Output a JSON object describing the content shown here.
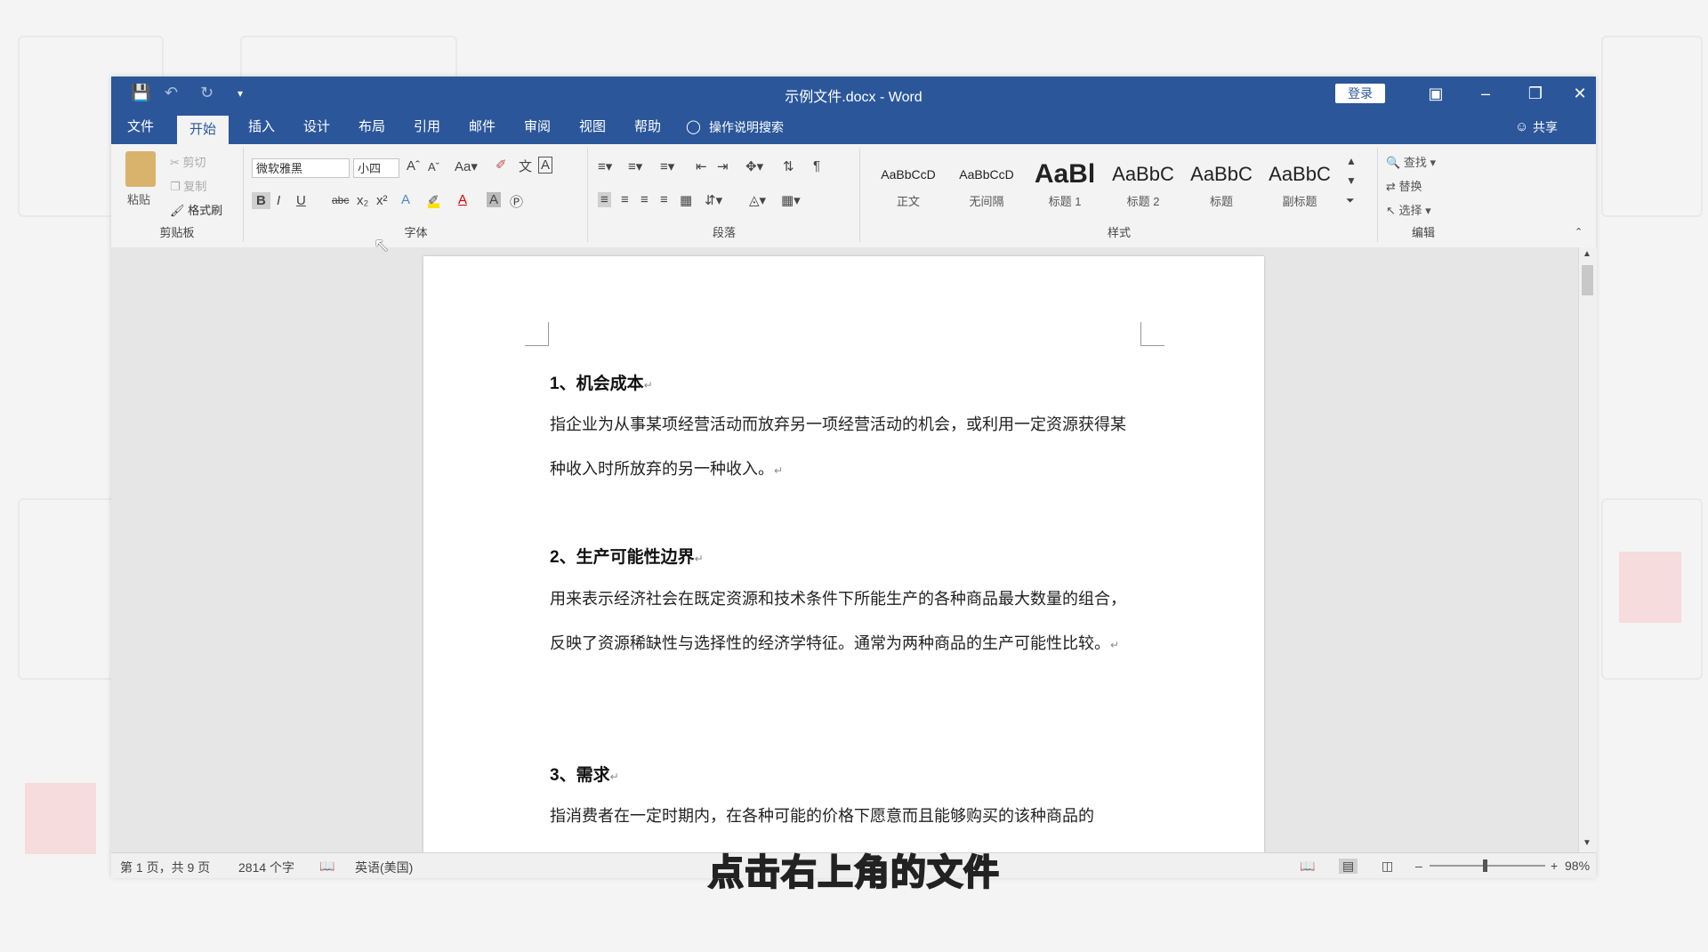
{
  "window": {
    "title": "示例文件.docx  -  Word",
    "login_label": "登录",
    "share_label": "共享"
  },
  "tabs": [
    "文件",
    "开始",
    "插入",
    "设计",
    "布局",
    "引用",
    "邮件",
    "审阅",
    "视图",
    "帮助"
  ],
  "active_tab": "开始",
  "tell_me": "操作说明搜索",
  "ribbon": {
    "clipboard": {
      "paste": "粘贴",
      "cut": "剪切",
      "copy": "复制",
      "format_painter": "格式刷",
      "label": "剪贴板"
    },
    "font": {
      "name": "微软雅黑",
      "size": "小四",
      "label": "字体"
    },
    "paragraph": {
      "label": "段落"
    },
    "styles": {
      "label": "样式",
      "items": [
        {
          "preview": "AaBbCcD",
          "name": "正文"
        },
        {
          "preview": "AaBbCcD",
          "name": "无间隔"
        },
        {
          "preview": "AaBl",
          "name": "标题 1"
        },
        {
          "preview": "AaBbC",
          "name": "标题 2"
        },
        {
          "preview": "AaBbC",
          "name": "标题"
        },
        {
          "preview": "AaBbC",
          "name": "副标题"
        }
      ]
    },
    "editing": {
      "find": "查找",
      "replace": "替换",
      "select": "选择",
      "label": "编辑"
    }
  },
  "document": {
    "sections": [
      {
        "heading": "1、机会成本",
        "body": "指企业为从事某项经营活动而放弃另一项经营活动的机会，或利用一定资源获得某种收入时所放弃的另一种收入。"
      },
      {
        "heading": "2、生产可能性边界",
        "body": "用来表示经济社会在既定资源和技术条件下所能生产的各种商品最大数量的组合，反映了资源稀缺性与选择性的经济学特征。通常为两种商品的生产可能性比较。"
      },
      {
        "heading": "3、需求",
        "body": "指消费者在一定时期内，在各种可能的价格下愿意而且能够购买的该种商品的"
      }
    ]
  },
  "status": {
    "page": "第 1 页，共 9 页",
    "words": "2814 个字",
    "language": "英语(美国)",
    "zoom": "98%"
  },
  "caption": "点击右上角的文件"
}
